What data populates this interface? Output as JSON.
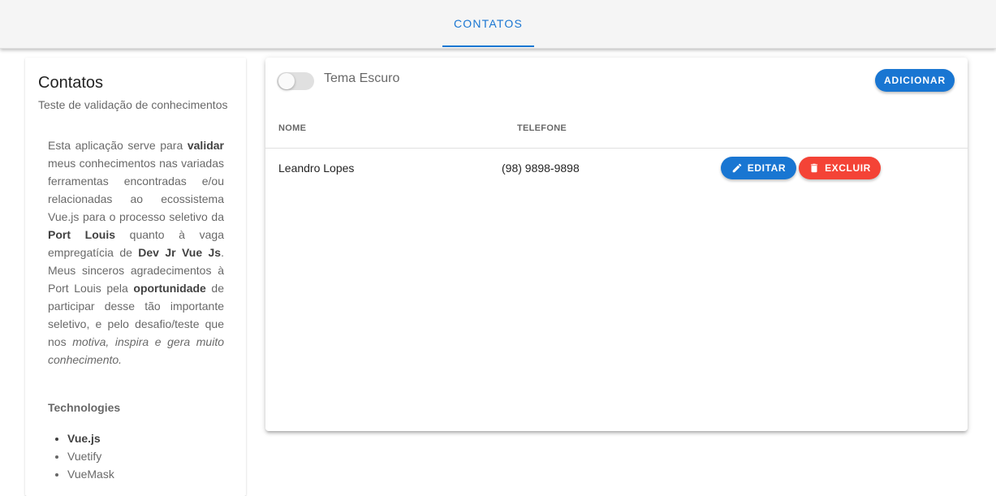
{
  "colors": {
    "primary": "#1976d2",
    "error": "#f44336",
    "topbar_bg": "#f5f5f5"
  },
  "nav": {
    "tabs": [
      {
        "label": "CONTATOS",
        "active": true
      }
    ]
  },
  "sidebar": {
    "title": "Contatos",
    "subtitle": "Teste de validação de conhecimentos",
    "technologies_title": "Technologies",
    "technologies": [
      "Vue.js",
      "Vuetify",
      "VueMask"
    ]
  },
  "main": {
    "dark_theme_toggle": {
      "label": "Tema Escuro",
      "checked": false
    },
    "add_button": "ADICIONAR",
    "table": {
      "headers": [
        "NOME",
        "TELEFONE"
      ],
      "rows": [
        {
          "name": "Leandro Lopes",
          "phone": "(98) 9898-9898"
        }
      ],
      "edit_label": "EDITAR",
      "delete_label": "EXCLUIR",
      "edit_icon": "pencil-icon",
      "delete_icon": "trash-icon"
    }
  }
}
